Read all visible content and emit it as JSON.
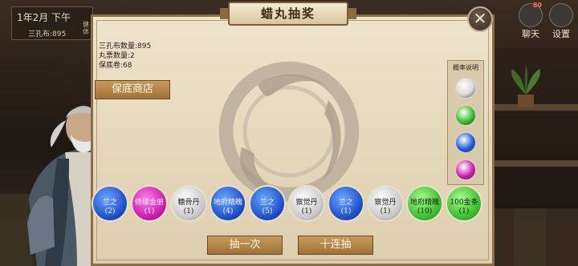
{
  "hud": {
    "date": "1年2月 下午",
    "coins_line": "三孔布:895",
    "side_chars": [
      "健",
      "体"
    ],
    "chat_label": "聊天",
    "chat_badge": "80",
    "settings_label": "设置"
  },
  "dialog": {
    "title": "蜡丸抽奖",
    "close_glyph": "✕",
    "stats": [
      "三孔布数量:895",
      "丸票数量:2",
      "保底卷:68"
    ],
    "shop_button": "保底商店",
    "prob_title": "概率说明",
    "prob_colors": [
      "#d8d8d8",
      "#3bbf2f",
      "#1f5fe0",
      "#d21fb4"
    ],
    "pills": [
      {
        "name": "兰之",
        "count": "(2)",
        "color": "blue"
      },
      {
        "name": "修续金册",
        "count": "(1)",
        "color": "magenta"
      },
      {
        "name": "糖骨丹",
        "count": "(1)",
        "color": "silver"
      },
      {
        "name": "地府精魄",
        "count": "(4)",
        "color": "blue"
      },
      {
        "name": "兰之",
        "count": "(5)",
        "color": "blue"
      },
      {
        "name": "察觉丹",
        "count": "(1)",
        "color": "silver"
      },
      {
        "name": "兰之",
        "count": "(1)",
        "color": "blue"
      },
      {
        "name": "察觉丹",
        "count": "(1)",
        "color": "silver"
      },
      {
        "name": "地府精魄",
        "count": "(10)",
        "color": "green"
      },
      {
        "name": "100金条",
        "count": "(1)",
        "color": "green"
      }
    ],
    "draw_once": "抽一次",
    "draw_ten": "十连抽"
  }
}
